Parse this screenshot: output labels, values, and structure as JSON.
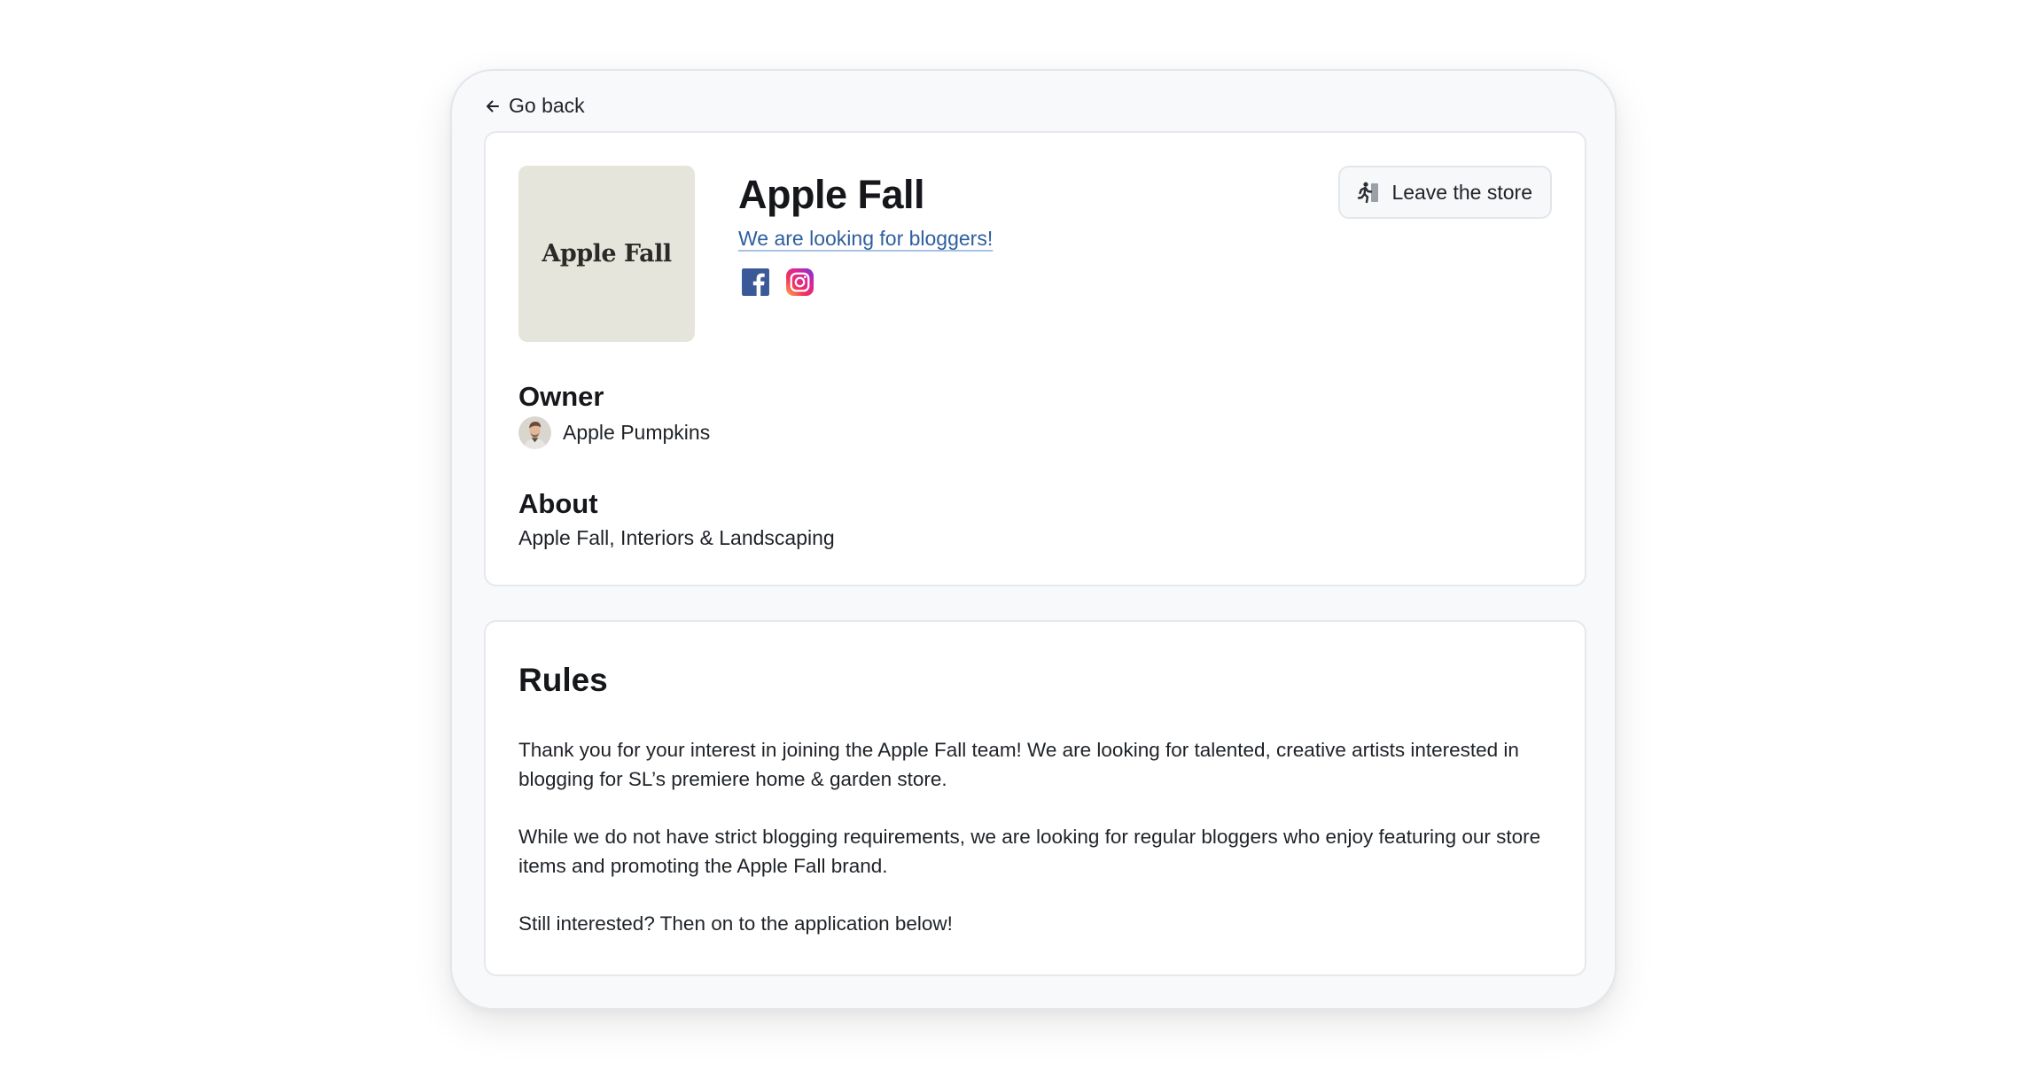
{
  "nav": {
    "back_label": "Go back",
    "back_icon": "arrow-left-icon"
  },
  "store": {
    "logo_text": "Apple Fall",
    "name": "Apple Fall",
    "tagline": "We are looking for bloggers!",
    "socials": [
      {
        "icon": "facebook-icon",
        "color": "#3b5998"
      },
      {
        "icon": "instagram-icon",
        "color": "#d6249f"
      }
    ],
    "logo_background": "#e6e5db"
  },
  "actions": {
    "leave_label": "Leave the store",
    "leave_icon": "running-exit-icon"
  },
  "owner": {
    "heading": "Owner",
    "name": "Apple Pumpkins"
  },
  "about": {
    "heading": "About",
    "text": "Apple Fall, Interiors & Landscaping"
  },
  "rules": {
    "heading": "Rules",
    "paragraphs": [
      "Thank you for your interest in joining the Apple Fall team! We are looking for talented, creative artists interested in blogging for SL’s premiere home & garden store.",
      "While we do not have strict blogging requirements, we are looking for regular bloggers who enjoy featuring our store items and promoting the Apple Fall brand.",
      "Still interested? Then on to the application below!"
    ]
  },
  "colors": {
    "link": "#2e5f9e",
    "text": "#1f2328",
    "frame_background": "#f8f9fb"
  }
}
